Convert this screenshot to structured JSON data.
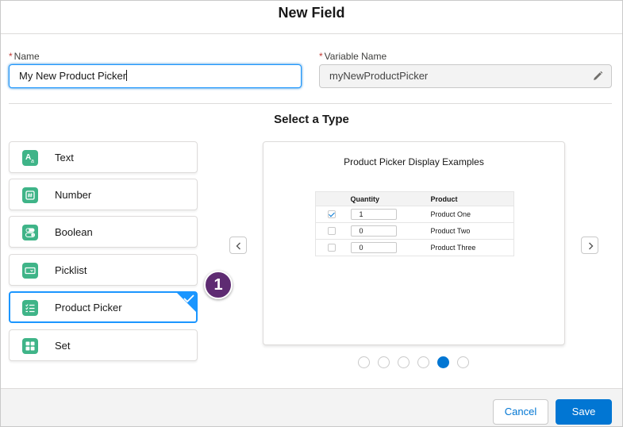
{
  "modal": {
    "title": "New Field"
  },
  "form": {
    "name_label": "Name",
    "name_value": "My New Product Picker",
    "required_mark": "*",
    "variable_label": "Variable Name",
    "variable_value": "myNewProductPicker",
    "edit_icon": "pencil-icon"
  },
  "type_section": {
    "title": "Select a Type",
    "types": [
      {
        "label": "Text",
        "icon": "text-icon"
      },
      {
        "label": "Number",
        "icon": "number-icon"
      },
      {
        "label": "Boolean",
        "icon": "toggle-icon"
      },
      {
        "label": "Picklist",
        "icon": "picklist-icon"
      },
      {
        "label": "Product Picker",
        "icon": "checklist-icon",
        "selected": true
      },
      {
        "label": "Set",
        "icon": "grid-icon"
      }
    ],
    "callout_number": "1"
  },
  "preview": {
    "title": "Product Picker Display Examples",
    "columns": [
      "",
      "Quantity",
      "Product"
    ],
    "rows": [
      {
        "checked": true,
        "quantity": "1",
        "product": "Product One"
      },
      {
        "checked": false,
        "quantity": "0",
        "product": "Product Two"
      },
      {
        "checked": false,
        "quantity": "0",
        "product": "Product Three"
      }
    ],
    "pagination": {
      "total": 6,
      "active": 5
    }
  },
  "footer": {
    "cancel_label": "Cancel",
    "save_label": "Save"
  },
  "colors": {
    "brand": "#0176d3",
    "icon_green": "#3fb488",
    "callout": "#5e2b72",
    "required": "#c23934"
  }
}
